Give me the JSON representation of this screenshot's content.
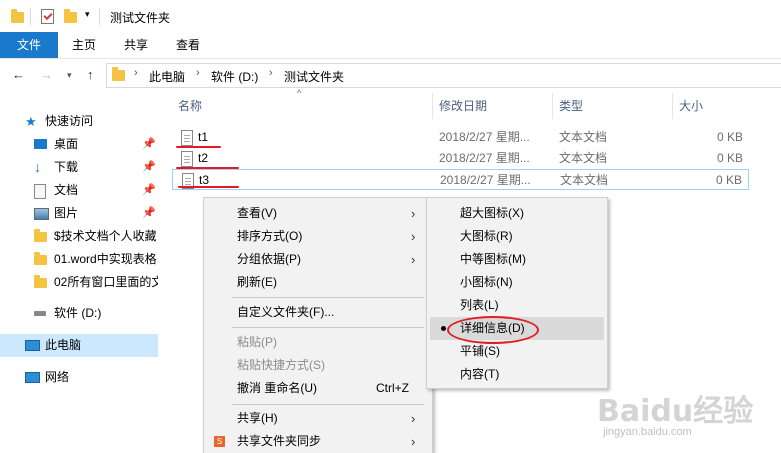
{
  "window": {
    "title": "测试文件夹"
  },
  "ribbon": {
    "tabs": [
      "文件",
      "主页",
      "共享",
      "查看"
    ]
  },
  "address": {
    "crumbs": [
      "此电脑",
      "软件 (D:)",
      "测试文件夹"
    ]
  },
  "nav": {
    "quick_access": "快速访问",
    "items": [
      {
        "label": "桌面",
        "icon": "desktop-icon",
        "pinned": true
      },
      {
        "label": "下载",
        "icon": "download-icon",
        "pinned": true
      },
      {
        "label": "文档",
        "icon": "document-icon",
        "pinned": true
      },
      {
        "label": "图片",
        "icon": "picture-icon",
        "pinned": true
      },
      {
        "label": "$技术文档个人收藏",
        "icon": "folder-icon",
        "pinned": false
      },
      {
        "label": "01.word中实现表格",
        "icon": "folder-icon",
        "pinned": false
      },
      {
        "label": "02所有窗口里面的文",
        "icon": "folder-icon",
        "pinned": false
      },
      {
        "label": "软件 (D:)",
        "icon": "drive-icon",
        "pinned": false
      }
    ],
    "this_pc": "此电脑",
    "network": "网络"
  },
  "columns": {
    "name": "名称",
    "date": "修改日期",
    "type": "类型",
    "size": "大小"
  },
  "files": [
    {
      "name": "t1",
      "date": "2018/2/27 星期...",
      "type": "文本文档",
      "size": "0 KB"
    },
    {
      "name": "t2",
      "date": "2018/2/27 星期...",
      "type": "文本文档",
      "size": "0 KB"
    },
    {
      "name": "t3",
      "date": "2018/2/27 星期...",
      "type": "文本文档",
      "size": "0 KB"
    }
  ],
  "context_menu": {
    "view": "查看(V)",
    "sort": "排序方式(O)",
    "group": "分组依据(P)",
    "refresh": "刷新(E)",
    "customize": "自定义文件夹(F)...",
    "paste": "粘贴(P)",
    "paste_shortcut": "粘贴快捷方式(S)",
    "undo": "撤消 重命名(U)",
    "undo_shortcut": "Ctrl+Z",
    "share": "共享(H)",
    "sync": "共享文件夹同步"
  },
  "view_submenu": {
    "xl_icons": "超大图标(X)",
    "large_icons": "大图标(R)",
    "medium_icons": "中等图标(M)",
    "small_icons": "小图标(N)",
    "list": "列表(L)",
    "details": "详细信息(D)",
    "tiles": "平铺(S)",
    "content": "内容(T)",
    "selected": "details"
  },
  "watermark": {
    "brand": "Baidu经验",
    "url": "jingyan.baidu.com"
  },
  "colors": {
    "accent": "#1979ca",
    "highlight_red": "#e31b23",
    "selection": "#cce8ff"
  }
}
